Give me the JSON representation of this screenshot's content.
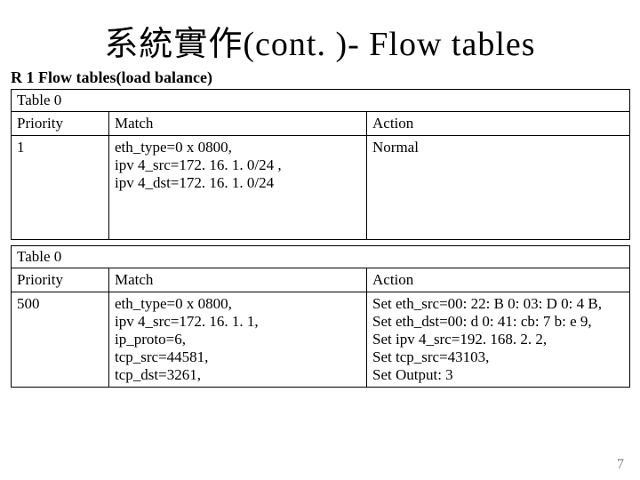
{
  "title": "系統實作(cont. )- Flow tables",
  "subheading": "R 1 Flow tables(load balance)",
  "tables": [
    {
      "caption": "Table 0",
      "headers": {
        "priority": "Priority",
        "match": "Match",
        "action": "Action"
      },
      "rows": [
        {
          "priority": "1",
          "match": "eth_type=0 x 0800,\nipv 4_src=172. 16. 1. 0/24 ,\nipv 4_dst=172. 16. 1. 0/24",
          "action": "Normal"
        }
      ]
    },
    {
      "caption": "Table 0",
      "headers": {
        "priority": "Priority",
        "match": "Match",
        "action": "Action"
      },
      "rows": [
        {
          "priority": "500",
          "match": "eth_type=0 x 0800,\nipv 4_src=172. 16. 1. 1,\nip_proto=6,\ntcp_src=44581,\ntcp_dst=3261,",
          "action": "Set eth_src=00: 22: B 0: 03: D 0: 4 B,\nSet eth_dst=00: d 0: 41: cb: 7 b: e 9,\nSet ipv 4_src=192. 168. 2. 2,\nSet tcp_src=43103,\nSet Output: 3"
        }
      ]
    }
  ],
  "page_number": "7"
}
